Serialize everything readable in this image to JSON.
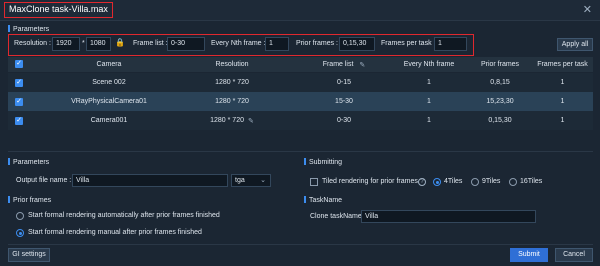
{
  "window": {
    "title": "MaxClone task-Villa.max",
    "close_glyph": "✕"
  },
  "params": {
    "section_label": "Parameters",
    "resolution_label": "Resolution :",
    "res_width": "1920",
    "res_sep": "*",
    "res_height": "1080",
    "lock_icon": "🔒",
    "frame_list_label": "Frame list :",
    "frame_list": "0-30",
    "every_nth_label": "Every Nth frame :",
    "every_nth": "1",
    "prior_label": "Prior frames :",
    "prior": "0,15,30",
    "fpt_label": "Frames per task :",
    "fpt": "1",
    "apply_all": "Apply all"
  },
  "table": {
    "headers": [
      "Camera",
      "Resolution",
      "Frame list",
      "Every Nth frame",
      "Prior frames",
      "Frames per task"
    ],
    "rows": [
      {
        "camera": "Scene 002",
        "resolution": "1280 * 720",
        "frames": "0-15",
        "nth": "1",
        "prior": "0,8,15",
        "fpt": "1"
      },
      {
        "camera": "VRayPhysicalCamera01",
        "resolution": "1280 * 720",
        "frames": "15-30",
        "nth": "1",
        "prior": "15,23,30",
        "fpt": "1"
      },
      {
        "camera": "Camera001",
        "resolution": "1280 * 720",
        "frames": "0-30",
        "nth": "1",
        "prior": "0,15,30",
        "fpt": "1"
      }
    ],
    "check_glyph": "✓"
  },
  "lower_params": {
    "section_label": "Parameters",
    "output_label": "Output file name :",
    "output_value": "Villa",
    "format_value": "tga"
  },
  "submitting": {
    "section_label": "Submitting",
    "tiled_label": "Tiled rendering for prior frames",
    "tiles": [
      "4Tiles",
      "9Tiles",
      "16Tiles"
    ]
  },
  "prior_frames": {
    "section_label": "Prior frames",
    "option_auto": "Start formal rendering automatically after prior frames finished",
    "option_manual": "Start formal rendering manual after prior frames finished"
  },
  "taskname": {
    "section_label": "TaskName",
    "clone_label": "Clone taskName :",
    "clone_value": "Villa"
  },
  "footer": {
    "gi_settings": "GI settings",
    "submit": "Submit",
    "cancel": "Cancel"
  },
  "colors": {
    "accent": "#3c8df0",
    "highlight_border": "#e0282e",
    "background": "#1b2633"
  }
}
